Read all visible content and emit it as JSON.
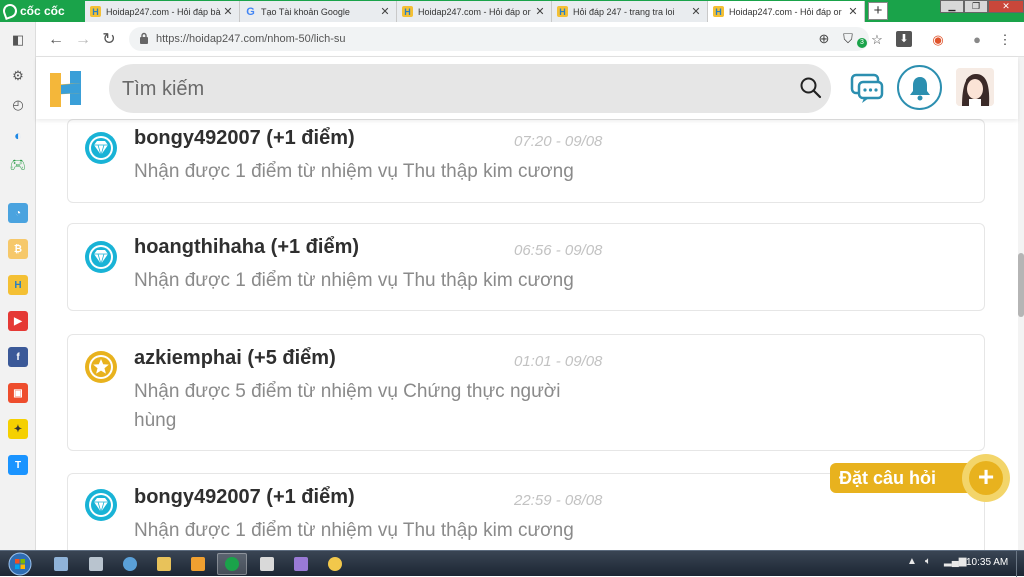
{
  "browser": {
    "brand": "cốc cốc",
    "tabs": [
      {
        "title": "Hoidap247.com - Hỏi đáp bà",
        "favicon": "hoidap-icon"
      },
      {
        "title": "Tạo Tài khoản Google",
        "favicon": "google-icon"
      },
      {
        "title": "Hoidap247.com - Hỏi đáp or",
        "favicon": "hoidap-icon"
      },
      {
        "title": "Hỏi đáp 247 - trang tra loi",
        "favicon": "hoidap-icon"
      },
      {
        "title": "Hoidap247.com - Hỏi đáp or",
        "favicon": "hoidap-icon",
        "active": true
      }
    ],
    "new_tab_label": "+",
    "url": "https://hoidap247.com/nhom-50/lich-su",
    "extension_badge": "3"
  },
  "site": {
    "search_placeholder": "Tìm kiếm",
    "colors": {
      "brand_yellow": "#e8b21e",
      "brand_blue": "#2c8fb0",
      "diamond": "#19b3d6"
    }
  },
  "history": [
    {
      "user": "bongy492007 (+1 điểm)",
      "time": "07:20 - 09/08",
      "description": "Nhận được 1 điểm từ nhiệm vụ Thu thập kim cương",
      "badge": "diamond-badge-icon"
    },
    {
      "user": "hoangthihaha (+1 điểm)",
      "time": "06:56 - 09/08",
      "description": "Nhận được 1 điểm từ nhiệm vụ Thu thập kim cương",
      "badge": "diamond-badge-icon"
    },
    {
      "user": "azkiemphai (+5 điểm)",
      "time": "01:01 - 09/08",
      "description": "Nhận được 5 điểm từ nhiệm vụ Chứng thực người hùng",
      "badge": "star-badge-icon"
    },
    {
      "user": "bongy492007 (+1 điểm)",
      "time": "22:59 - 08/08",
      "description": "Nhận được 1 điểm từ nhiệm vụ Thu thập kim cương",
      "badge": "diamond-badge-icon"
    }
  ],
  "fab": {
    "label": "Đặt câu hỏi",
    "plus": "+"
  },
  "taskbar": {
    "clock": "10:35 AM"
  }
}
